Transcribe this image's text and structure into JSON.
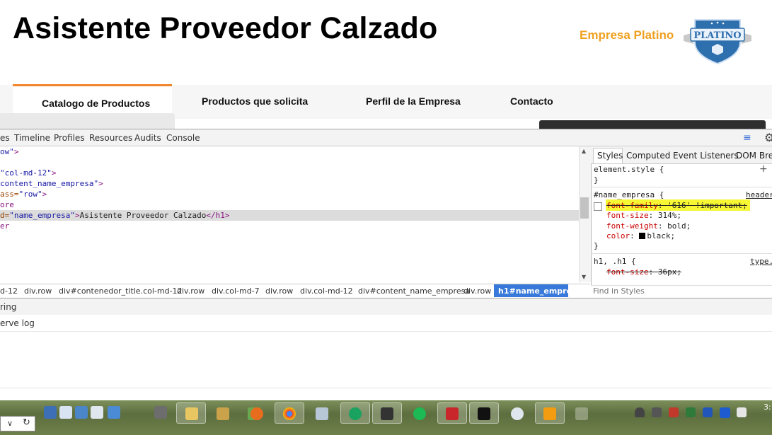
{
  "site": {
    "title": "Asistente Proveedor Calzado",
    "badge_text": "Empresa Platino",
    "badge_logo_text": "PLATINO"
  },
  "nav": {
    "tabs": [
      "Catalogo de Productos",
      "Productos que solicita",
      "Perfil de la Empresa",
      "Contacto"
    ],
    "active_index": 0,
    "accent_color": "#f0852b"
  },
  "devtools": {
    "panel_tabs": [
      "es",
      "Timeline",
      "Profiles",
      "Resources",
      "Audits",
      "Console"
    ],
    "code_lines": [
      {
        "parts": [
          [
            "val",
            "ow\""
          ],
          [
            "tag",
            ">"
          ]
        ]
      },
      {
        "parts": []
      },
      {
        "parts": [
          [
            "val",
            "\"col-md-12\""
          ],
          [
            "tag",
            ">"
          ]
        ]
      },
      {
        "parts": [
          [
            "val",
            "content_name_empresa\""
          ],
          [
            "tag",
            ">"
          ]
        ]
      },
      {
        "parts": [
          [
            "attr",
            "ass="
          ],
          [
            "val",
            "\"row\""
          ],
          [
            "tag",
            ">"
          ]
        ]
      },
      {
        "parts": [
          [
            "tag",
            "ore"
          ]
        ]
      },
      {
        "parts": [
          [
            "attr",
            "d="
          ],
          [
            "val",
            "\"name_empresa\""
          ],
          [
            "tag",
            ">"
          ],
          [
            "txt",
            "Asistente Proveedor Calzado"
          ],
          [
            "tag",
            "</h1>"
          ]
        ]
      },
      {
        "parts": [
          [
            "tag",
            "er"
          ]
        ]
      }
    ],
    "breadcrumbs": [
      "d-12",
      "div.row",
      "div#contenedor_title.col-md-12",
      "div.row",
      "div.col-md-7",
      "div.row",
      "div.col-md-12",
      "div#content_name_empresa",
      "div.row",
      "h1#name_empresa"
    ],
    "styles_tabs": [
      "Styles",
      "Computed",
      "Event Listeners",
      "DOM Brea"
    ],
    "element_style": "element.style {",
    "rule_selector": "#name_empresa {",
    "rule_source": "header",
    "rule_props": [
      {
        "name": "font-family",
        "value": "'616' !important;",
        "struck": true
      },
      {
        "name": "font-size",
        "value": "314%;",
        "struck": false
      },
      {
        "name": "font-weight",
        "value": "bold;",
        "struck": false
      },
      {
        "name": "color",
        "value": "black;",
        "struck": false
      }
    ],
    "rule2_selector": "h1, .h1 {",
    "rule2_source": "type.",
    "rule2_prop": {
      "name": "font-size",
      "value": "36px;"
    },
    "close_brace": "}",
    "find_placeholder": "Find in Styles",
    "console_filter": "ring",
    "console_option": "erve log"
  },
  "taskbar": {
    "clock": "3:"
  }
}
